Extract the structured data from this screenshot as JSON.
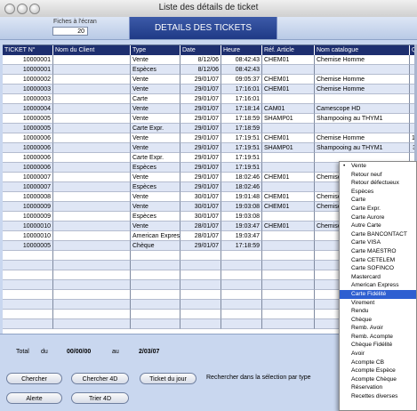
{
  "window": {
    "title": "Liste des détails de ticket"
  },
  "topbar": {
    "fiches_label": "Fiches à l'écran",
    "fiches_value": "20",
    "banner": "DETAILS DES TICKETS"
  },
  "table": {
    "headers": [
      "TICKET N°",
      "Nom du Client",
      "Type",
      "Date",
      "Heure",
      "Réf. Article",
      "Nom catalogue",
      "Qté"
    ],
    "rows": [
      [
        "10000001",
        "",
        "Vente",
        "8/12/06",
        "08:42:43",
        "CHEM01",
        "Chemise Homme",
        ""
      ],
      [
        "10000001",
        "",
        "Espèces",
        "8/12/06",
        "08:42:43",
        "",
        "",
        ""
      ],
      [
        "10000002",
        "",
        "Vente",
        "29/01/07",
        "09:05:37",
        "CHEM01",
        "Chemise Homme",
        ""
      ],
      [
        "10000003",
        "",
        "Vente",
        "29/01/07",
        "17:16:01",
        "CHEM01",
        "Chemise Homme",
        ""
      ],
      [
        "10000003",
        "",
        "Carte",
        "29/01/07",
        "17:16:01",
        "",
        "",
        ""
      ],
      [
        "10000004",
        "",
        "Vente",
        "29/01/07",
        "17:18:14",
        "CAM01",
        "Camescope HD",
        ""
      ],
      [
        "10000005",
        "",
        "Vente",
        "29/01/07",
        "17:18:59",
        "SHAMP01",
        "Shampooing au THYM1",
        ""
      ],
      [
        "10000005",
        "",
        "Carte Expr.",
        "29/01/07",
        "17:18:59",
        "",
        "",
        ""
      ],
      [
        "10000006",
        "",
        "Vente",
        "29/01/07",
        "17:19:51",
        "CHEM01",
        "Chemise Homme",
        "12"
      ],
      [
        "10000006",
        "",
        "Vente",
        "29/01/07",
        "17:19:51",
        "SHAMP01",
        "Shampooing au THYM1",
        "3"
      ],
      [
        "10000006",
        "",
        "Carte Expr.",
        "29/01/07",
        "17:19:51",
        "",
        "",
        ""
      ],
      [
        "10000006",
        "",
        "Espèces",
        "29/01/07",
        "17:19:51",
        "",
        "",
        ""
      ],
      [
        "10000007",
        "",
        "Vente",
        "29/01/07",
        "18:02:46",
        "CHEM01",
        "Chemise H",
        ""
      ],
      [
        "10000007",
        "",
        "Espèces",
        "29/01/07",
        "18:02:46",
        "",
        "",
        ""
      ],
      [
        "10000008",
        "",
        "Vente",
        "30/01/07",
        "19:01:48",
        "CHEM01",
        "Chemise H",
        ""
      ],
      [
        "10000009",
        "",
        "Vente",
        "30/01/07",
        "19:03:08",
        "CHEM01",
        "Chemise H",
        ""
      ],
      [
        "10000009",
        "",
        "Espèces",
        "30/01/07",
        "19:03:08",
        "",
        "",
        ""
      ],
      [
        "10000010",
        "",
        "Vente",
        "28/01/07",
        "19:03:47",
        "CHEM01",
        "Chemise H",
        ""
      ],
      [
        "10000010",
        "",
        "American Express",
        "28/01/07",
        "19:03:47",
        "",
        "",
        ""
      ],
      [
        "10000005",
        "",
        "Chèque",
        "29/01/07",
        "17:18:59",
        "",
        "",
        ""
      ]
    ],
    "empty_rows": 8
  },
  "footer": {
    "total_label": "Total",
    "du_label": "du",
    "date_from": "00/00/00",
    "au_label": "au",
    "date_to": "2/03/07",
    "buttons": {
      "chercher": "Chercher",
      "chercher4d": "Chercher 4D",
      "ticket_du_jour": "Ticket du jour",
      "alerte": "Alerte",
      "trier4d": "Trier 4D"
    },
    "search_by_type_label": "Rechercher dans la sélection par type"
  },
  "type_menu": {
    "items": [
      "Vente",
      "Retour neuf",
      "Retour défectueux",
      "Espèces",
      "Carte",
      "Carte Expr.",
      "Carte Aurore",
      "Autre Carte",
      "Carte BANCONTACT",
      "Carte VISA",
      "Carte MAESTRO",
      "Carte CETELEM",
      "Carte SOFINCO",
      "Mastercard",
      "American Express",
      "Carte Fidélité",
      "Virement",
      "Rendu",
      "Chèque",
      "Remb. Avoir",
      "Remb. Acompte",
      "Chèque Fidélité",
      "Avoir",
      "Acompte CB",
      "Acompte Espèce",
      "Acompte Chèque",
      "Réservation",
      "Recettes diverses"
    ],
    "checked_index": 0,
    "selected_index": 15
  }
}
